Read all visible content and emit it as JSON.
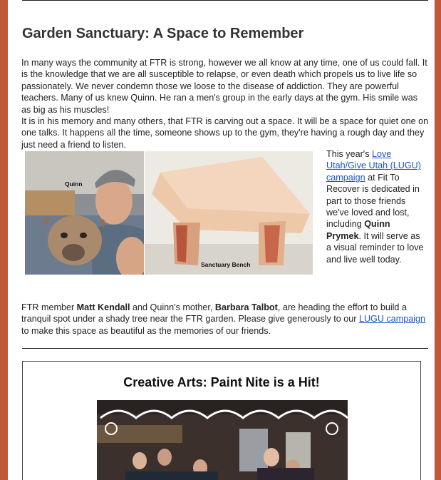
{
  "colors": {
    "page_border": "#c0563a",
    "link": "#1a55c9",
    "heading": "#333333"
  },
  "garden": {
    "title": "Garden Sanctuary:  A Space to Remember",
    "para1": "In many ways the community at FTR is strong, however we all know at any time, one of us could fall.  It is the knowledge that we are all susceptible to relapse, or even death which propels us to live life so passionately.  We never condemn those we loose to the disease of addiction.  They are powerful teachers.  Many of us knew Quinn.  He ran a men's group in the early days at the gym.  His smile was as big as his muscles!",
    "para2": "It is in his memory and many others, that FTR is carving out a space.  It will be a space for quiet one on one talks.  It happens all the time, someone shows up to the gym, they're having a rough day and they just need a friend to listen.",
    "photo1_label": "Quinn",
    "photo2_label": "Sanctuary Bench",
    "side_pre": "This year's ",
    "side_link": "Love Utah/Give Utah (LUGU) campaign",
    "side_mid": " at Fit To Recover is dedicated in part to those friends we've loved and lost, including ",
    "side_name": "Quinn Prymek",
    "side_post": ".  It will serve as a visual reminder to love and live well today.",
    "para3_a": "FTR member ",
    "para3_name1": "Matt Kendall",
    "para3_b": " and Quinn's mother, ",
    "para3_name2": "Barbara Talbot",
    "para3_c": ", are heading the effort to build a tranquil spot under a shady tree near the FTR garden.  Please give generously to our ",
    "para3_link": "LUGU campaign",
    "para3_d": " to make this space as beautiful as the memories of our friends."
  },
  "creative": {
    "title": "Creative Arts: Paint Nite is a Hit!"
  }
}
